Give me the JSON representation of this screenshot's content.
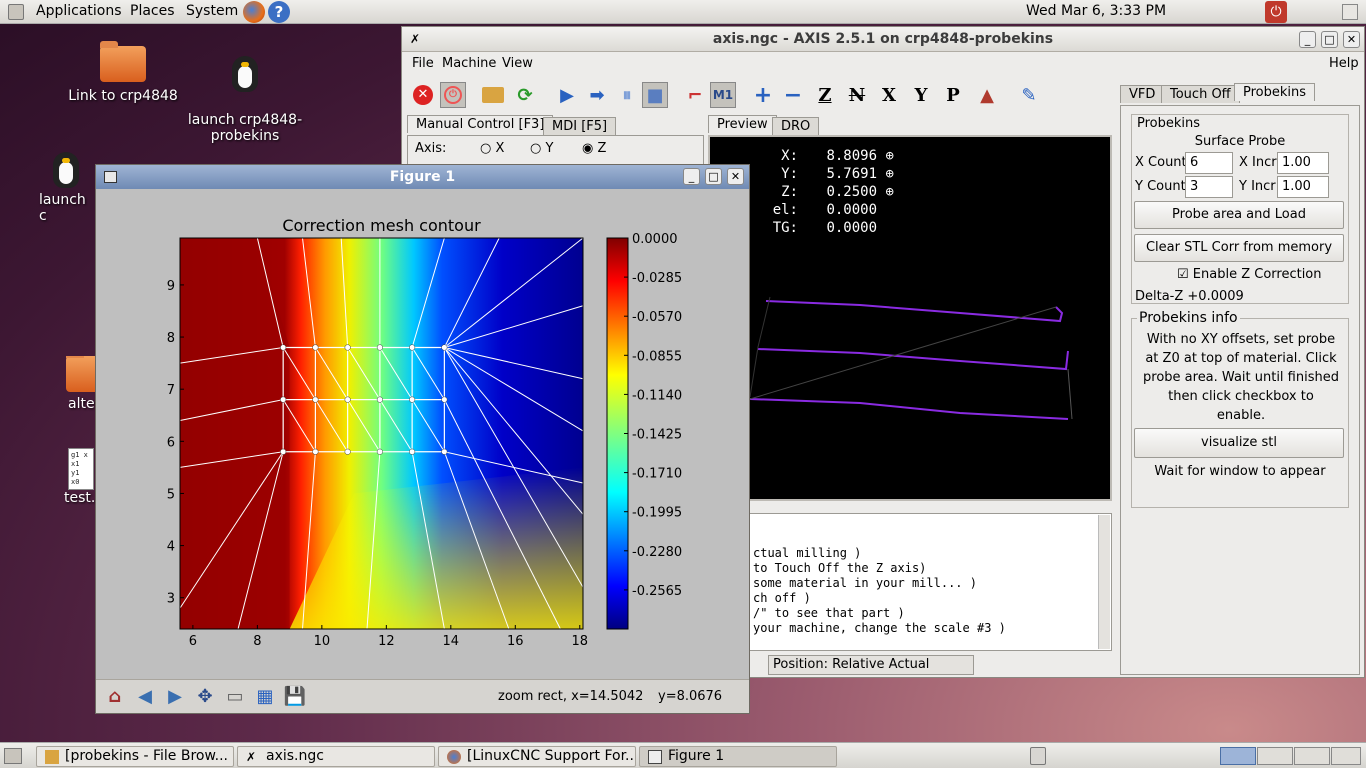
{
  "top_panel": {
    "menus": [
      "Applications",
      "Places",
      "System"
    ],
    "clock": "Wed Mar  6,  3:33 PM"
  },
  "desktop": {
    "icons": [
      {
        "label": "Link to crp4848"
      },
      {
        "label": "launch crp4848-\nprobekins"
      },
      {
        "label": "launch c"
      },
      {
        "label": "alte"
      },
      {
        "label": "test.n"
      }
    ],
    "test_file_lines": [
      "g1 x",
      "x1",
      "y1",
      "x0"
    ]
  },
  "axis": {
    "title": "axis.ngc - AXIS 2.5.1 on crp4848-probekins",
    "menu": [
      "File",
      "Machine",
      "View"
    ],
    "help": "Help",
    "tabs": [
      "Manual Control [F3]",
      "MDI [F5]"
    ],
    "axis_label": "Axis:",
    "radios": [
      "X",
      "Y",
      "Z"
    ],
    "view_tabs": [
      "Preview",
      "DRO"
    ],
    "dro": [
      {
        "label": "X:",
        "value": "8.8096"
      },
      {
        "label": "Y:",
        "value": "5.7691"
      },
      {
        "label": "Z:",
        "value": "0.2500"
      },
      {
        "label": "el:",
        "value": "0.0000"
      },
      {
        "label": "TG:",
        "value": "0.0000"
      }
    ],
    "gcode_lines": [
      "ctual milling )",
      "to Touch Off the Z axis)",
      "some material in your mill... )",
      "ch off )",
      "/\" to see that part )",
      "your machine, change the scale #3 )"
    ],
    "status": "Position: Relative Actual",
    "toolbar": [
      "Z",
      "N",
      "X",
      "Y",
      "P"
    ],
    "right_tabs": [
      "VFD",
      "Touch Off",
      "Probekins"
    ],
    "probekins": {
      "group": "Probekins",
      "subtitle": "Surface Probe",
      "x_count_label": "X Count",
      "x_count": "6",
      "x_incr_label": "X Incr",
      "x_incr": "1.00",
      "y_count_label": "Y Count",
      "y_count": "3",
      "y_incr_label": "Y Incr",
      "y_incr": "1.00",
      "probe_btn": "Probe area and Load",
      "clear_btn": "Clear STL Corr from memory",
      "enable_label": "Enable Z Correction",
      "delta": "Delta-Z +0.0009",
      "info_title": "Probekins info",
      "info_text": "With no XY offsets, set probe at Z0 at top of material. Click probe area. Wait until finished then click checkbox to enable.",
      "visualize_btn": "visualize stl",
      "wait_text": "Wait for window to appear"
    }
  },
  "figure": {
    "title": "Figure 1",
    "status_coords": "zoom rect, x=14.5042",
    "status_y": "y=8.0676"
  },
  "chart_data": {
    "type": "heatmap",
    "title": "Correction mesh contour",
    "xlabel": "",
    "ylabel": "",
    "xlim": [
      5.6,
      18.1
    ],
    "ylim": [
      2.4,
      9.9
    ],
    "x_ticks": [
      "6",
      "8",
      "10",
      "12",
      "14",
      "16",
      "18"
    ],
    "y_ticks": [
      "3",
      "4",
      "5",
      "6",
      "7",
      "8",
      "9"
    ],
    "mesh_x": [
      8.8,
      9.8,
      10.8,
      11.8,
      12.8,
      13.8
    ],
    "mesh_y": [
      5.8,
      6.8,
      7.8
    ],
    "colorbar_ticks": [
      "0.0000",
      "-0.0285",
      "-0.0570",
      "-0.0855",
      "-0.1140",
      "-0.1425",
      "-0.1710",
      "-0.1995",
      "-0.2280",
      "-0.2565"
    ],
    "colorbar_range": [
      -0.285,
      0.0
    ],
    "colormap": "jet"
  },
  "taskbar": {
    "items": [
      "[probekins - File Brow...",
      "axis.ngc",
      "[LinuxCNC Support For...",
      "Figure 1"
    ]
  },
  "colors": {
    "accent": "#4a6fa5",
    "trace": "#8a2be2"
  }
}
